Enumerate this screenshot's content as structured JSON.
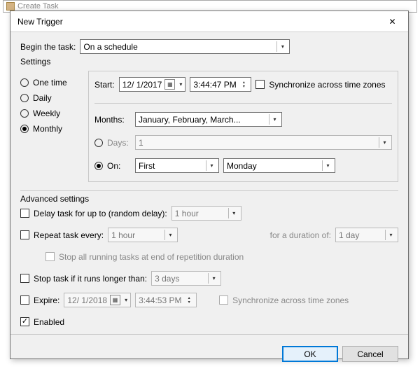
{
  "parent_window_title": "Create Task",
  "title": "New Trigger",
  "begin_task_label": "Begin the task:",
  "begin_task_value": "On a schedule",
  "settings_label": "Settings",
  "freq": {
    "one_time": "One time",
    "daily": "Daily",
    "weekly": "Weekly",
    "monthly": "Monthly",
    "selected": "monthly"
  },
  "detail": {
    "start_label": "Start:",
    "start_date": "12/ 1/2017",
    "start_time": "3:44:47 PM",
    "sync_label": "Synchronize across time zones",
    "months_label": "Months:",
    "months_value": "January, February, March...",
    "days_label": "Days:",
    "days_value": "1",
    "on_label": "On:",
    "on_ordinal": "First",
    "on_day": "Monday",
    "day_mode_selected": "on"
  },
  "advanced_label": "Advanced settings",
  "advanced": {
    "delay_label": "Delay task for up to (random delay):",
    "delay_value": "1 hour",
    "repeat_label": "Repeat task every:",
    "repeat_value": "1 hour",
    "duration_label": "for a duration of:",
    "duration_value": "1 day",
    "stop_end_label": "Stop all running tasks at end of repetition duration",
    "stop_longer_label": "Stop task if it runs longer than:",
    "stop_longer_value": "3 days",
    "expire_label": "Expire:",
    "expire_date": "12/ 1/2018",
    "expire_time": "3:44:53 PM",
    "expire_sync_label": "Synchronize across time zones",
    "enabled_label": "Enabled"
  },
  "buttons": {
    "ok": "OK",
    "cancel": "Cancel"
  }
}
